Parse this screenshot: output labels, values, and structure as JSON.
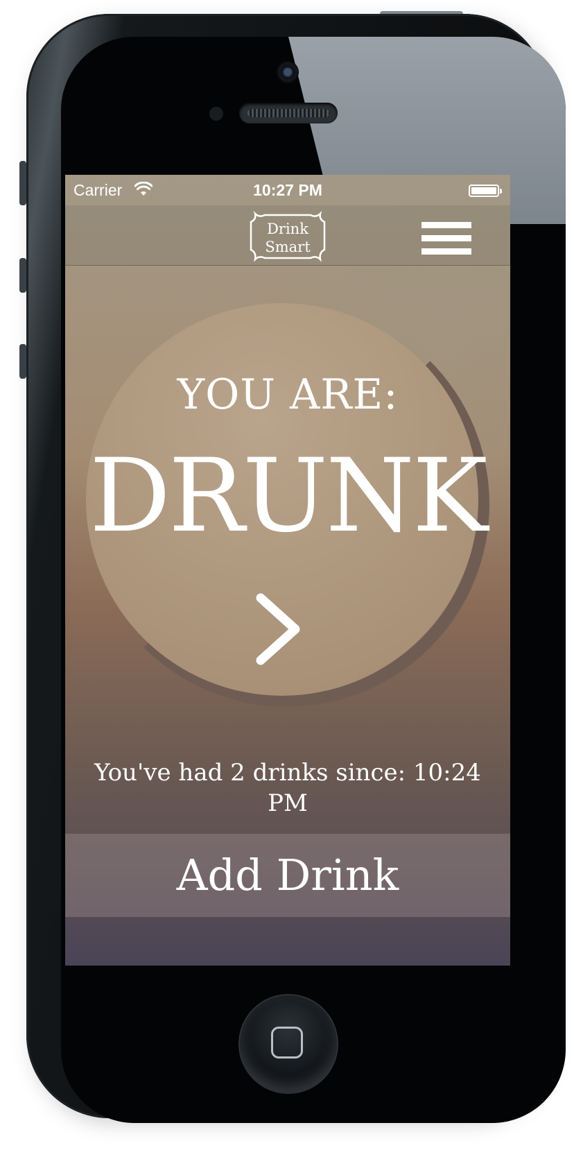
{
  "status_bar": {
    "carrier": "Carrier",
    "time": "10:27 PM"
  },
  "nav": {
    "logo_line1": "Drink",
    "logo_line2": "Smart"
  },
  "status": {
    "heading": "YOU ARE:",
    "state": "DRUNK"
  },
  "drinks_summary": "You've had 2 drinks since: 10:24 PM",
  "add_drink_label": "Add Drink",
  "colors": {
    "text": "#ffffff",
    "ring": "#6f5d54",
    "circle": "#b09a80"
  }
}
